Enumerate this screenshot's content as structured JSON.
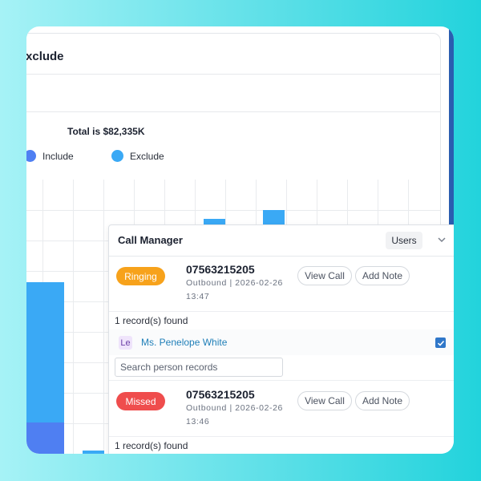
{
  "report": {
    "title": "Exclude",
    "total_text": "Total is $82,335K",
    "legend": [
      {
        "label": "Include",
        "color": "#4f7ff2"
      },
      {
        "label": "Exclude",
        "color": "#3aa9f5"
      }
    ]
  },
  "call_manager": {
    "title": "Call Manager",
    "users_label": "Users",
    "calls": [
      {
        "status": "Ringing",
        "status_bg": "#f7a21b",
        "status_color": "#ffffff",
        "number": "07563215205",
        "direction_date": "Outbound | 2026-02-26",
        "time": "13:47",
        "view_label": "View Call",
        "note_label": "Add Note",
        "records_found": "1 record(s) found",
        "person_initials": "Le",
        "person_name": "Ms. Penelope White",
        "person_selected": true,
        "search_placeholder": "Search person records"
      },
      {
        "status": "Missed",
        "status_bg": "#ef4d4d",
        "status_color": "#ffffff",
        "number": "07563215205",
        "direction_date": "Outbound | 2026-02-26",
        "time": "13:46",
        "view_label": "View Call",
        "note_label": "Add Note",
        "records_found": "1 record(s) found"
      }
    ]
  }
}
